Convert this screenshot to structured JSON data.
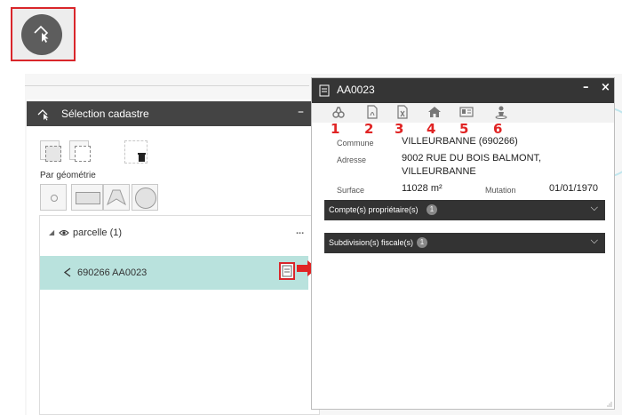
{
  "left_panel": {
    "title": "Sélection cadastre",
    "minimize": "–",
    "geometry_label": "Par géométrie"
  },
  "tree": {
    "layer_label": "parcelle (1)",
    "menu": "...",
    "item_label": "690266 AA0023"
  },
  "right_panel": {
    "title": "AA0023",
    "minimize": "–",
    "close": "×",
    "toolbar_numbers": [
      "1",
      "2",
      "3",
      "4",
      "5",
      "6"
    ],
    "fields": {
      "commune_label": "Commune",
      "commune_value": "VILLEURBANNE (690266)",
      "adresse_label": "Adresse",
      "adresse_value_line1": "9002 RUE DU BOIS BALMONT,",
      "adresse_value_line2": "VILLEURBANNE",
      "surface_label": "Surface",
      "surface_value": "11028 m²",
      "mutation_label": "Mutation",
      "mutation_value": "01/01/1970"
    },
    "sections": [
      {
        "label": "Compte(s) propriétaire(s)",
        "count": "1"
      },
      {
        "label": "Subdivision(s) fiscale(s)",
        "count": "1"
      }
    ]
  },
  "colors": {
    "accent_red": "#d9262b",
    "header_dark": "#353535",
    "selected_row": "#b9e2dd"
  }
}
